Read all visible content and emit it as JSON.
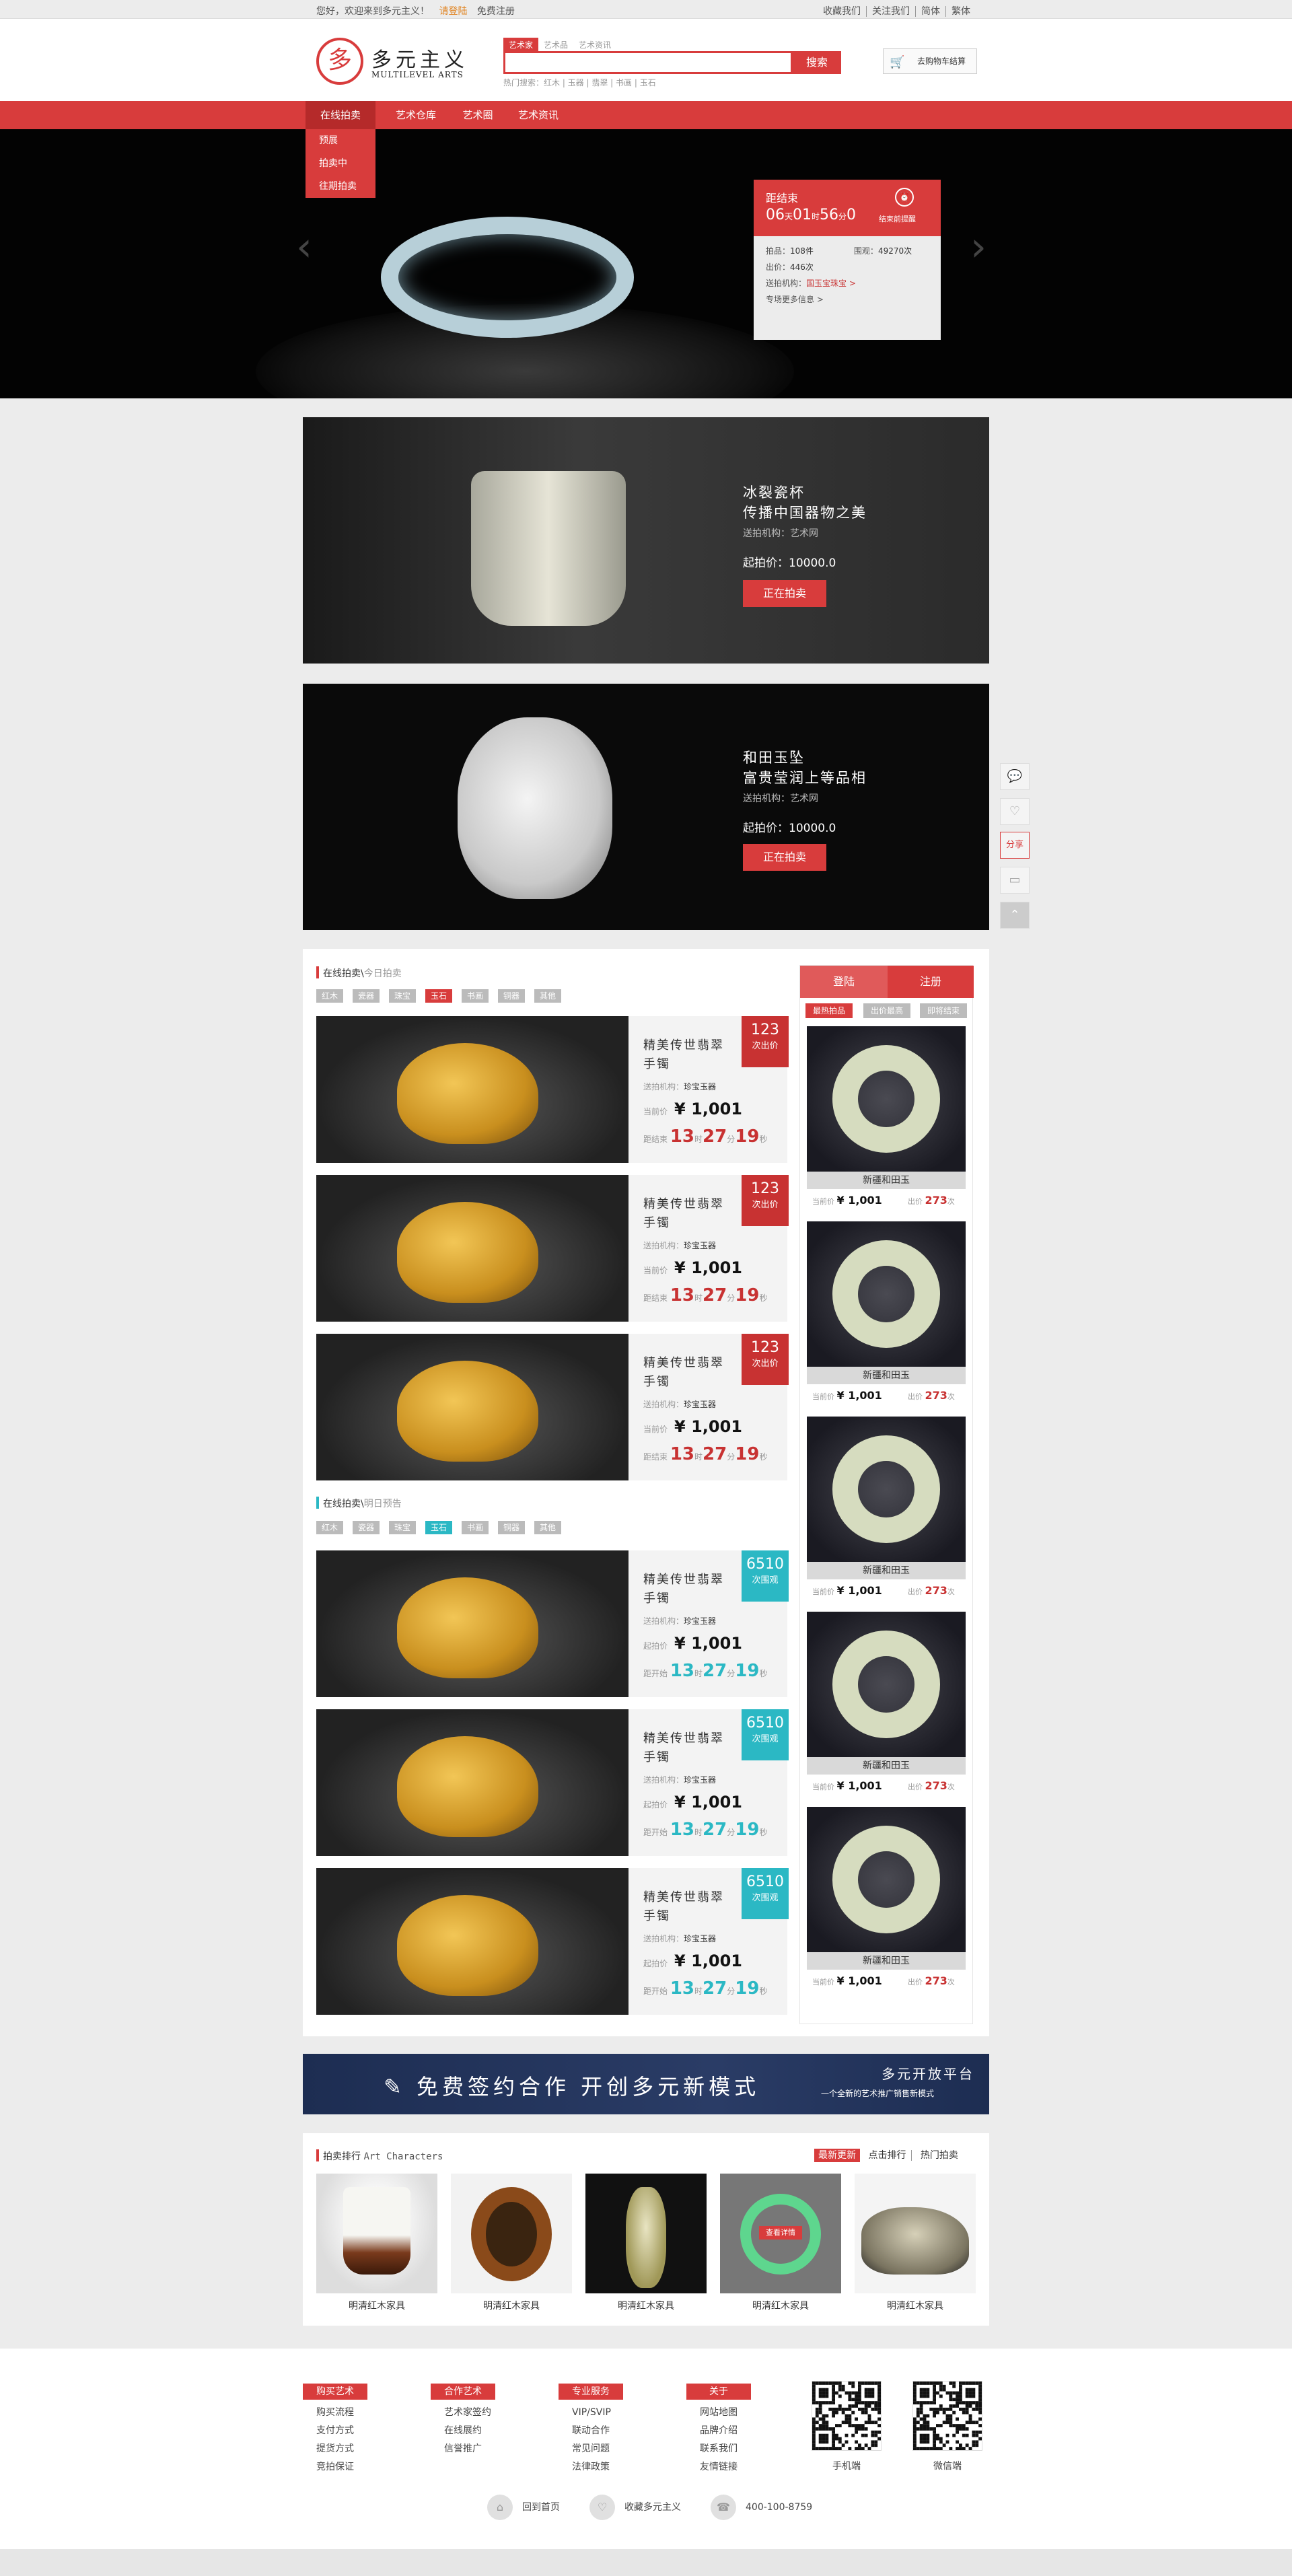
{
  "topbar": {
    "welcome": "您好，欢迎来到多元主义！",
    "login": "请登陆",
    "register": "免费注册",
    "links": [
      "收藏我们",
      "关注我们",
      "简体",
      "繁体"
    ]
  },
  "header": {
    "logo_seal": "多",
    "logo_cn": "多元主义",
    "logo_en": "MULTILEVEL ARTS",
    "search_tabs": [
      "艺术家",
      "艺术品",
      "艺术资讯"
    ],
    "search_placeholder": "",
    "search_button": "搜索",
    "hot_words": "热门搜索：红木 | 玉器 | 翡翠 | 书画 | 玉石",
    "cart": "去购物车结算"
  },
  "nav": {
    "items": [
      "在线拍卖",
      "艺术仓库",
      "艺术圈",
      "艺术资讯"
    ],
    "dropdown": [
      "预展",
      "拍卖中",
      "往期拍卖"
    ]
  },
  "banner": {
    "countdown_label": "距结束",
    "countdown": {
      "d": "06",
      "h": "01",
      "m": "56",
      "s": "0"
    },
    "units": {
      "d": "天",
      "h": "时",
      "m": "分",
      "s": "秒"
    },
    "remind": "结束前提醒",
    "lots_label": "拍品：",
    "lots": "108件",
    "views_label": "围观：",
    "views": "49270次",
    "bids_label": "出价：",
    "bids": "446次",
    "org_label": "送拍机构：",
    "org": "国玉宝珠宝 >",
    "more": "专场更多信息 >"
  },
  "promos": [
    {
      "title1": "冰裂瓷杯",
      "title2": "传播中国器物之美",
      "org": "送拍机构：艺术网",
      "price": "起拍价：10000.0",
      "button": "正在拍卖"
    },
    {
      "title1": "和田玉坠",
      "title2": "富贵莹润上等品相",
      "org": "送拍机构：艺术网",
      "price": "起拍价：10000.0",
      "button": "正在拍卖"
    }
  ],
  "side_tools": {
    "share": "分享"
  },
  "today": {
    "title": "在线拍卖\\",
    "sub": "今日拍卖",
    "filters": [
      "红木",
      "瓷器",
      "珠宝",
      "玉石",
      "书画",
      "铜器",
      "其他"
    ],
    "items": [
      {
        "name": "精美传世翡翠手镯",
        "badge_num": "123",
        "badge_text": "次出价",
        "org_label": "送拍机构：",
        "org": "珍宝玉器",
        "price_label": "当前价",
        "price": "¥ 1,001",
        "cd_label": "距结束",
        "h": "13",
        "m": "27",
        "s": "19",
        "hu": "时",
        "mu": "分",
        "su": "秒"
      },
      {
        "name": "精美传世翡翠手镯",
        "badge_num": "123",
        "badge_text": "次出价",
        "org_label": "送拍机构：",
        "org": "珍宝玉器",
        "price_label": "当前价",
        "price": "¥ 1,001",
        "cd_label": "距结束",
        "h": "13",
        "m": "27",
        "s": "19",
        "hu": "时",
        "mu": "分",
        "su": "秒"
      },
      {
        "name": "精美传世翡翠手镯",
        "badge_num": "123",
        "badge_text": "次出价",
        "org_label": "送拍机构：",
        "org": "珍宝玉器",
        "price_label": "当前价",
        "price": "¥ 1,001",
        "cd_label": "距结束",
        "h": "13",
        "m": "27",
        "s": "19",
        "hu": "时",
        "mu": "分",
        "su": "秒"
      }
    ]
  },
  "tomorrow": {
    "title": "在线拍卖\\",
    "sub": "明日预告",
    "filters": [
      "红木",
      "瓷器",
      "珠宝",
      "玉石",
      "书画",
      "铜器",
      "其他"
    ],
    "items": [
      {
        "name": "精美传世翡翠手镯",
        "badge_num": "6510",
        "badge_text": "次围观",
        "org_label": "送拍机构：",
        "org": "珍宝玉器",
        "price_label": "起拍价",
        "price": "¥ 1,001",
        "cd_label": "距开始",
        "h": "13",
        "m": "27",
        "s": "19",
        "hu": "时",
        "mu": "分",
        "su": "秒"
      },
      {
        "name": "精美传世翡翠手镯",
        "badge_num": "6510",
        "badge_text": "次围观",
        "org_label": "送拍机构：",
        "org": "珍宝玉器",
        "price_label": "起拍价",
        "price": "¥ 1,001",
        "cd_label": "距开始",
        "h": "13",
        "m": "27",
        "s": "19",
        "hu": "时",
        "mu": "分",
        "su": "秒"
      },
      {
        "name": "精美传世翡翠手镯",
        "badge_num": "6510",
        "badge_text": "次围观",
        "org_label": "送拍机构：",
        "org": "珍宝玉器",
        "price_label": "起拍价",
        "price": "¥ 1,001",
        "cd_label": "距开始",
        "h": "13",
        "m": "27",
        "s": "19",
        "hu": "时",
        "mu": "分",
        "su": "秒"
      }
    ]
  },
  "right": {
    "login": "登陆",
    "register": "注册",
    "sorts": [
      "最热拍品",
      "出价最高",
      "即将结束"
    ],
    "items": [
      {
        "name": "新疆和田玉",
        "price_label": "当前价",
        "price": "¥ 1,001",
        "bid_label": "出价",
        "bids": "273",
        "bid_unit": "次"
      },
      {
        "name": "新疆和田玉",
        "price_label": "当前价",
        "price": "¥ 1,001",
        "bid_label": "出价",
        "bids": "273",
        "bid_unit": "次"
      },
      {
        "name": "新疆和田玉",
        "price_label": "当前价",
        "price": "¥ 1,001",
        "bid_label": "出价",
        "bids": "273",
        "bid_unit": "次"
      },
      {
        "name": "新疆和田玉",
        "price_label": "当前价",
        "price": "¥ 1,001",
        "bid_label": "出价",
        "bids": "273",
        "bid_unit": "次"
      },
      {
        "name": "新疆和田玉",
        "price_label": "当前价",
        "price": "¥ 1,001",
        "bid_label": "出价",
        "bids": "273",
        "bid_unit": "次"
      }
    ]
  },
  "ad": {
    "slogan": "免费签约合作 开创多元新模式",
    "right1": "多元开放平台",
    "right2": "一个全新的艺术推广销售新模式"
  },
  "ranking": {
    "title": "拍卖排行",
    "title_en": "Art Characters",
    "tabs": [
      "最新更新",
      "点击排行",
      "热门拍卖"
    ],
    "overlay": "查看详情",
    "items": [
      "明清红木家具",
      "明清红木家具",
      "明清红木家具",
      "明清红木家具",
      "明清红木家具"
    ]
  },
  "footer": {
    "cols": [
      {
        "head": "购买艺术",
        "items": [
          "购买流程",
          "支付方式",
          "提货方式",
          "竞拍保证"
        ]
      },
      {
        "head": "合作艺术",
        "items": [
          "艺术家签约",
          "在线展约",
          "信誉推广"
        ]
      },
      {
        "head": "专业服务",
        "items": [
          "VIP/SVIP",
          "联动合作",
          "常见问题",
          "法律政策"
        ]
      },
      {
        "head": "关于",
        "items": [
          "网站地图",
          "品牌介绍",
          "联系我们",
          "友情链接"
        ]
      }
    ],
    "qr": [
      "手机端",
      "微信端"
    ],
    "links": [
      "回到首页",
      "收藏多元主义",
      "400-100-8759"
    ]
  }
}
